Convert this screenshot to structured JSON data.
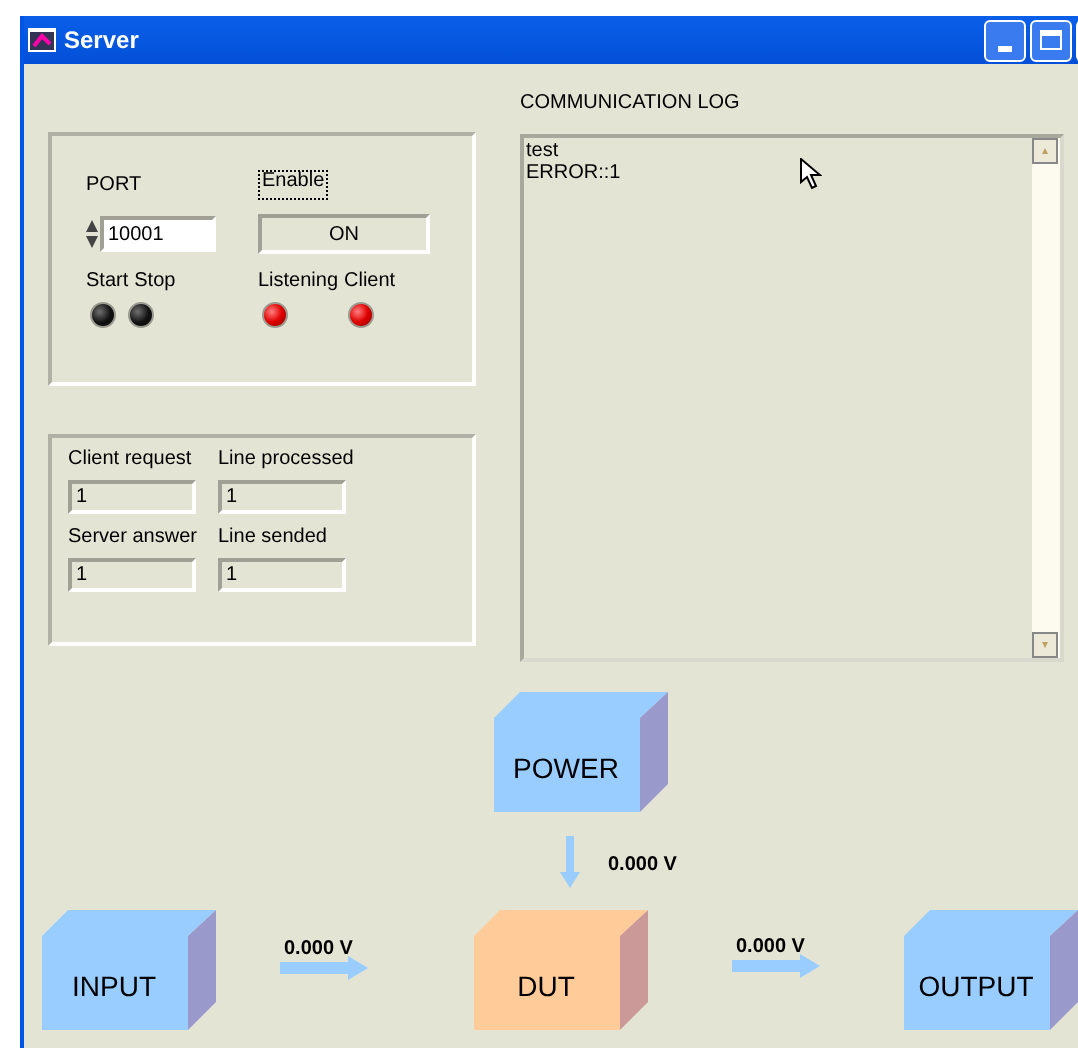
{
  "window": {
    "title": "Server"
  },
  "connection": {
    "port_label": "PORT",
    "port_value": "10001",
    "enable_label": "Enable",
    "enable_state": "ON",
    "leds": [
      {
        "label": "Start",
        "on": false
      },
      {
        "label": "Stop",
        "on": false
      },
      {
        "label": "Listening",
        "on": true
      },
      {
        "label": "Client",
        "on": true
      }
    ]
  },
  "counters": [
    {
      "label": "Client request",
      "value": "1"
    },
    {
      "label": "Line processed",
      "value": "1"
    },
    {
      "label": "Server answer",
      "value": "1"
    },
    {
      "label": "Line sended",
      "value": "1"
    }
  ],
  "log": {
    "title": "COMMUNICATION LOG",
    "lines": [
      "test",
      "ERROR::1"
    ]
  },
  "diagram": {
    "blocks": [
      {
        "label": "POWER",
        "color": "#99ccff"
      },
      {
        "label": "INPUT",
        "color": "#99ccff"
      },
      {
        "label": "DUT",
        "color": "#ffcc99"
      },
      {
        "label": "OUTPUT",
        "color": "#99ccff"
      }
    ],
    "readings": [
      "0.000 V",
      "0.000 V",
      "0.000 V"
    ]
  }
}
